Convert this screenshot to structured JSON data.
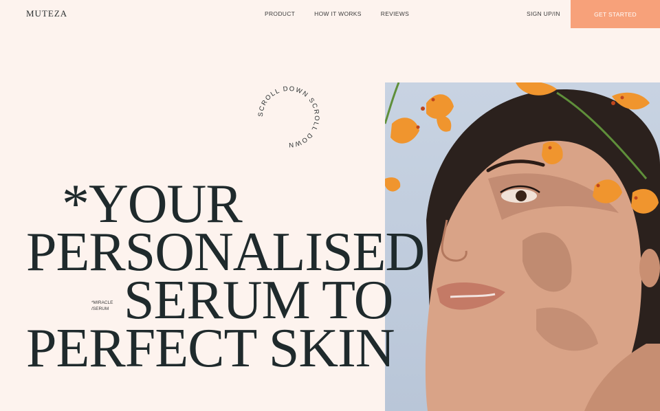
{
  "brand": {
    "logo": "MUTEZA"
  },
  "nav": {
    "items": [
      "PRODUCT",
      "HOW IT WORKS",
      "REVIEWS"
    ]
  },
  "header": {
    "signin": "SIGN UP/IN",
    "cta": "GET STARTED"
  },
  "hero": {
    "headline": [
      "*YOUR",
      "PERSONALISED",
      "SERUM TO",
      "PERFECT SKIN"
    ],
    "note_lines": [
      "*MIRACLE",
      "/SERUM"
    ],
    "scroll_text": "SCROLL DOWN  SCROLL DOWN  "
  },
  "colors": {
    "background": "#fdf3ee",
    "accent": "#f7a17a",
    "text": "#1f2a2c"
  }
}
